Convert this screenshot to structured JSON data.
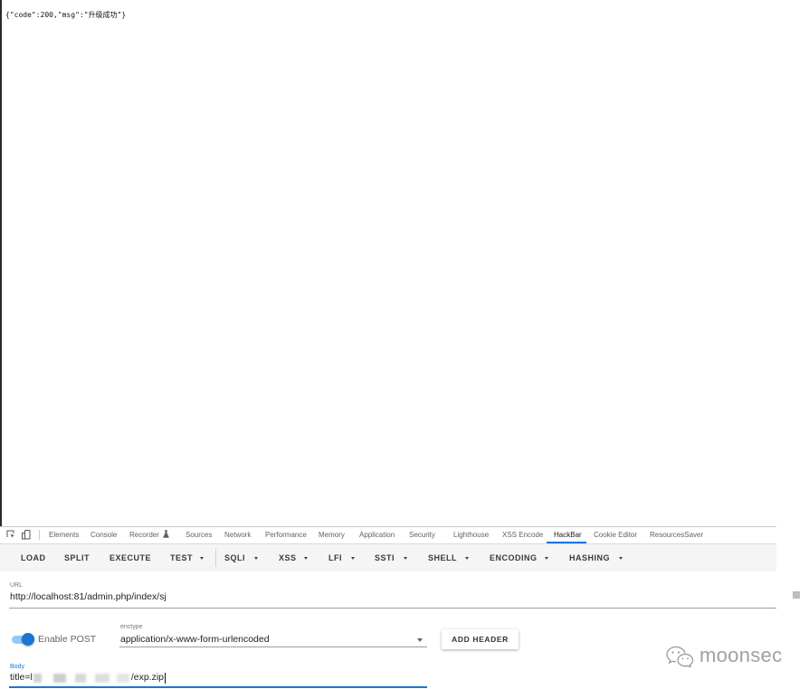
{
  "response": {
    "body_text": "{\"code\":200,\"msg\":\"升级成功\"}"
  },
  "devtools": {
    "toolbar_icons": [
      "inspect-element-icon",
      "device-toolbar-icon"
    ],
    "tabs": [
      {
        "label": "Elements"
      },
      {
        "label": "Console"
      },
      {
        "label": "Recorder",
        "icon": "flask-icon"
      },
      {
        "label": "Sources"
      },
      {
        "label": "Network"
      },
      {
        "label": "Performance"
      },
      {
        "label": "Memory"
      },
      {
        "label": "Application"
      },
      {
        "label": "Security"
      },
      {
        "label": "Lighthouse"
      },
      {
        "label": "XSS Encode"
      },
      {
        "label": "HackBar",
        "active": true
      },
      {
        "label": "Cookie Editor"
      },
      {
        "label": "ResourcesSaver"
      }
    ]
  },
  "hackbar": {
    "menu": [
      {
        "label": "LOAD"
      },
      {
        "label": "SPLIT"
      },
      {
        "label": "EXECUTE"
      },
      {
        "label": "TEST",
        "dropdown": true
      },
      {
        "label": "SQLI",
        "dropdown": true
      },
      {
        "label": "XSS",
        "dropdown": true
      },
      {
        "label": "LFI",
        "dropdown": true
      },
      {
        "label": "SSTI",
        "dropdown": true
      },
      {
        "label": "SHELL",
        "dropdown": true
      },
      {
        "label": "ENCODING",
        "dropdown": true
      },
      {
        "label": "HASHING",
        "dropdown": true
      }
    ],
    "dropdown_icon": "caret-down-icon",
    "url": {
      "label": "URL",
      "value": "http://localhost:81/admin.php/index/sj"
    },
    "enable_post": {
      "label": "Enable POST",
      "checked": true
    },
    "enctype": {
      "label": "enctype",
      "value": "application/x-www-form-urlencoded"
    },
    "add_header_button": "ADD HEADER",
    "body": {
      "label": "Body",
      "value_start": "title=l",
      "value_end": "/exp.zip",
      "middle_redacted": true
    }
  },
  "watermark": {
    "icon": "wechat-icon",
    "text": "moonsec"
  },
  "colors": {
    "accent": "#1976d2",
    "active_tab_underline": "#1a73e8",
    "toggle_track": "#90caf9"
  }
}
